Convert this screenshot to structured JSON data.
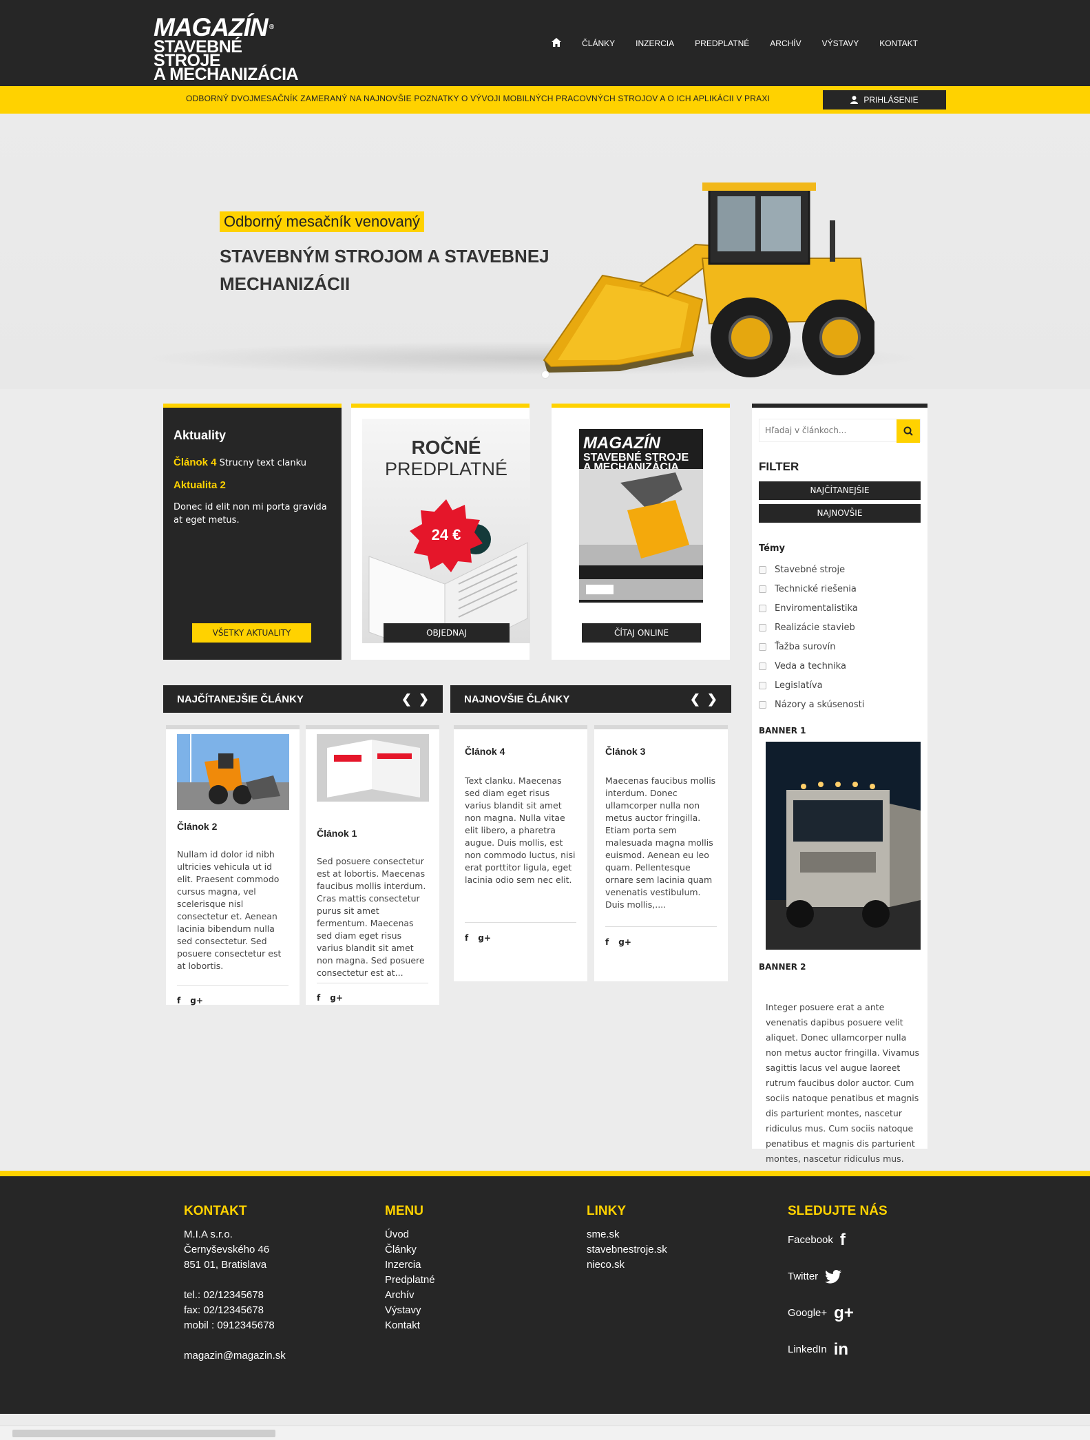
{
  "header": {
    "logo_line1": "MAGAZÍN",
    "logo_line2": "STAVEBNÉ STROJE",
    "logo_line3": "A MECHANIZÁCIA",
    "nav": [
      "ČLÁNKY",
      "INZERCIA",
      "PREDPLATNÉ",
      "ARCHÍV",
      "VÝSTAVY",
      "KONTAKT"
    ],
    "home_icon": "home-icon"
  },
  "tagline": "ODBORNÝ DVOJMESAČNÍK ZAMERANÝ NA NAJNOVŠIE POZNATKY O VÝVOJI MOBILNÝCH PRACOVNÝCH STROJOV A O ICH APLIKÁCII V PRAXI",
  "login_label": "PRIHLÁSENIE",
  "hero": {
    "subtitle": "Odborný mesačník venovaný",
    "title": "STAVEBNÝM STROJOM A STAVEBNEJ MECHANIZÁCII"
  },
  "aktuality": {
    "heading": "Aktuality",
    "item1_title": "Článok 4",
    "item1_text": "Strucny text clanku",
    "item2_title": "Aktualita 2",
    "item2_text": "Donec id elit non mi porta gravida at eget metus.",
    "button": "VŠETKY AKTUALITY"
  },
  "predplatne": {
    "line1": "ROČNÉ",
    "line2": "PREDPLATNÉ",
    "price": "24 €",
    "button": "OBJEDNAJ"
  },
  "magazine": {
    "button": "ČÍTAJ ONLINE"
  },
  "sidebar": {
    "search_placeholder": "Hľadaj v článkoch...",
    "filter_heading": "FILTER",
    "filter_btn1": "NAJČÍTANEJŠIE",
    "filter_btn2": "NAJNOVŠIE",
    "topics_heading": "Témy",
    "topics": [
      "Stavebné stroje",
      "Technické riešenia",
      "Enviromentalistika",
      "Realizácie stavieb",
      "Ťažba surovín",
      "Veda a technika",
      "Legislatíva",
      "Názory a skúsenosti"
    ],
    "banner1": "BANNER 1",
    "banner2": "BANNER 2",
    "banner2_text": "Integer posuere erat a ante venenatis dapibus posuere velit aliquet. Donec ullamcorper nulla non metus auctor fringilla. Vivamus sagittis lacus vel augue laoreet rutrum faucibus dolor auctor. Cum sociis natoque penatibus et magnis dis parturient montes, nascetur ridiculus mus. Cum sociis natoque penatibus et magnis dis parturient montes, nascetur ridiculus mus."
  },
  "most_read": {
    "heading": "NAJČÍTANEJŠIE ČLÁNKY",
    "articles": [
      {
        "title": "Článok 2",
        "text": "Nullam id dolor id nibh ultricies vehicula ut id elit. Praesent commodo cursus magna, vel scelerisque nisl consectetur et. Aenean lacinia bibendum nulla sed consectetur. Sed posuere consectetur est at lobortis."
      },
      {
        "title": "Článok 1",
        "text": "Sed posuere consectetur est at lobortis. Maecenas faucibus mollis interdum. Cras mattis consectetur purus sit amet fermentum. Maecenas sed diam eget risus varius blandit sit amet non magna. Sed posuere consectetur est at..."
      }
    ]
  },
  "newest": {
    "heading": "NAJNOVŠIE ČLÁNKY",
    "articles": [
      {
        "title": "Článok 4",
        "text": "Text clanku. Maecenas sed diam eget risus varius blandit sit amet non magna. Nulla vitae elit libero, a pharetra augue. Duis mollis, est non commodo luctus, nisi erat porttitor ligula, eget lacinia odio sem nec elit."
      },
      {
        "title": "Článok 3",
        "text": "Maecenas faucibus mollis interdum. Donec ullamcorper nulla non metus auctor fringilla. Etiam porta sem malesuada magna mollis euismod. Aenean eu leo quam. Pellentesque ornare sem lacinia quam venenatis vestibulum. Duis mollis,...."
      }
    ]
  },
  "social_share": {
    "fb": "f",
    "gplus": "g+"
  },
  "footer": {
    "kontakt_heading": "KONTAKT",
    "kontakt_lines": [
      "M.I.A s.r.o.",
      "Černyševského 46",
      "851 01, Bratislava",
      "",
      "tel.: 02/12345678",
      "fax: 02/12345678",
      "mobil : 0912345678",
      "",
      "magazin@magazin.sk"
    ],
    "menu_heading": "MENU",
    "menu_items": [
      "Úvod",
      "Články",
      "Inzercia",
      "Predplatné",
      "Archív",
      "Výstavy",
      "Kontakt"
    ],
    "linky_heading": "LINKY",
    "linky_items": [
      "sme.sk",
      "stavebnestroje.sk",
      "nieco.sk"
    ],
    "social_heading": "SLEDUJTE NÁS",
    "social_items": [
      {
        "label": "Facebook",
        "icon": "f"
      },
      {
        "label": "Twitter",
        "icon": "✦"
      },
      {
        "label": "Google+",
        "icon": "g+"
      },
      {
        "label": "LinkedIn",
        "icon": "in"
      }
    ]
  },
  "colors": {
    "accent": "#ffd200",
    "dark": "#262626",
    "bg": "#ececec"
  }
}
